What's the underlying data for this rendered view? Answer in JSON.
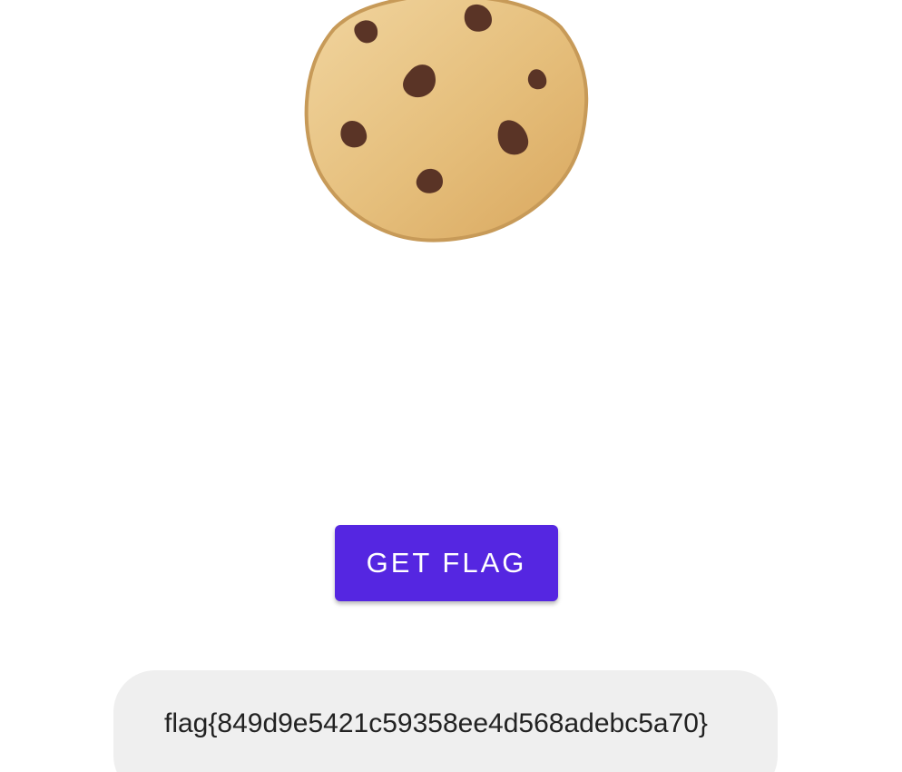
{
  "cookie": {
    "icon": "cookie-icon",
    "colors": {
      "dough": "#e7bf7d",
      "dough_edge": "#c99a56",
      "chips": "#5a3426"
    }
  },
  "actions": {
    "get_flag_label": "GET FLAG"
  },
  "result": {
    "flag_text": "flag{849d9e5421c59358ee4d568adebc5a70}"
  },
  "colors": {
    "accent": "#5526e1",
    "result_bg": "#efefef"
  }
}
